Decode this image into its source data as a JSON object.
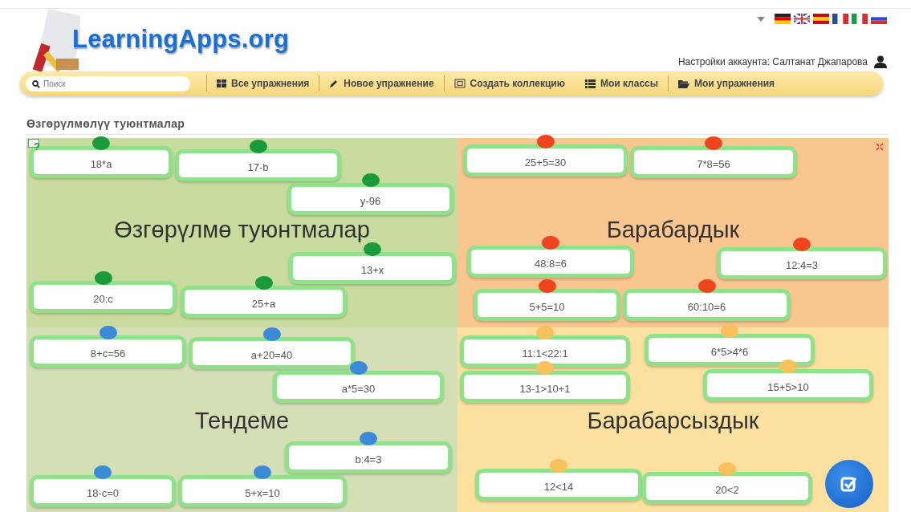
{
  "header": {
    "logo": "LearningApps.org",
    "account": "Настройки аккаунта: Салтанат Джапарова"
  },
  "nav": {
    "search": {
      "placeholder": "Поиск"
    },
    "items": [
      {
        "label": "Все упражнения",
        "divider": true
      },
      {
        "label": "Новое упражнение",
        "divider": true
      },
      {
        "label": "Создать коллекцию",
        "divider": true
      },
      {
        "label": "Мои классы",
        "divider": false
      },
      {
        "label": "Мои упражнения",
        "divider": true
      }
    ]
  },
  "page_title": "Өзгөрүлмөлүү туюнтмалар",
  "board": {
    "help": "?",
    "quadrants": [
      {
        "title": "Өзгөрүлмө туюнтмалар",
        "color": "#1a9a3a",
        "cards": [
          {
            "label": "18*a"
          },
          {
            "label": "17-b"
          },
          {
            "label": "y-96"
          },
          {
            "label": "13+x"
          },
          {
            "label": "20:c"
          },
          {
            "label": "25+a"
          }
        ]
      },
      {
        "title": "Барабардык",
        "color": "#f0441e",
        "cards": [
          {
            "label": "25+5=30"
          },
          {
            "label": "7*8=56"
          },
          {
            "label": "48:8=6"
          },
          {
            "label": "12:4=3"
          },
          {
            "label": "5+5=10"
          },
          {
            "label": "60:10=6"
          }
        ]
      },
      {
        "title": "Тендеме",
        "color": "#3a8ad8",
        "cards": [
          {
            "label": "8+c=56"
          },
          {
            "label": "a+20=40"
          },
          {
            "label": "a*5=30"
          },
          {
            "label": "b:4=3"
          },
          {
            "label": "18-c=0"
          },
          {
            "label": "5+x=10"
          }
        ]
      },
      {
        "title": "Барабарсыздык",
        "color": "#f8c15c",
        "cards": [
          {
            "label": "11:1<22:1"
          },
          {
            "label": "6*5>4*6"
          },
          {
            "label": "13-1>10+1"
          },
          {
            "label": "15+5>10"
          },
          {
            "label": "12<14"
          },
          {
            "label": "20<2"
          }
        ]
      }
    ]
  }
}
